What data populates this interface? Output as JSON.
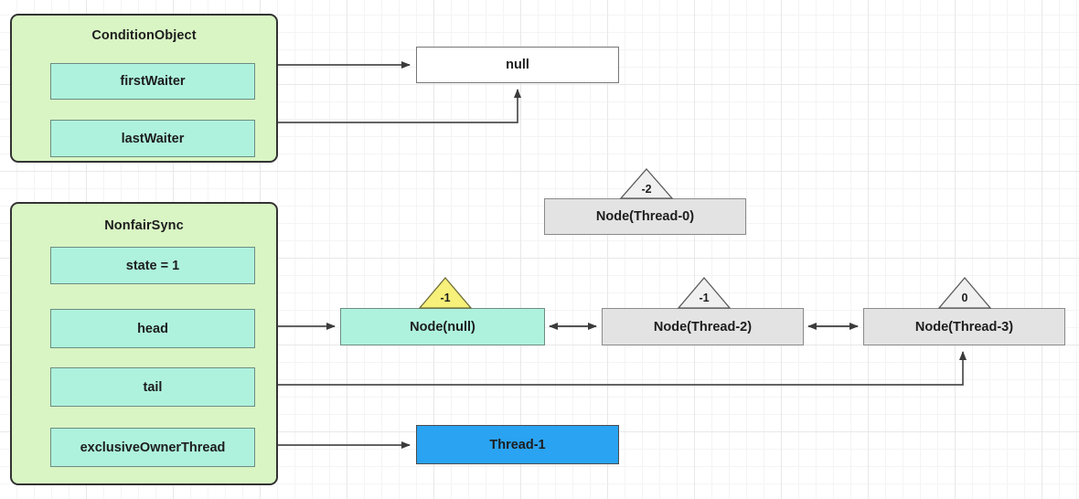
{
  "diagram": {
    "title": "AQS ReentrantLock internal state diagram",
    "colors": {
      "group_fill": "#d9f5c4",
      "field_fill": "#aef2dd",
      "node_gray_fill": "#e3e3e3",
      "node_teal_fill": "#aef2dd",
      "node_white_fill": "#ffffff",
      "thread_blue_fill": "#29a3f2",
      "badge_yellow_fill": "#f7f07a",
      "badge_gray_fill": "#f0f0f0",
      "edge_stroke": "#4d4d4d",
      "border_dark": "#333333"
    }
  },
  "groups": [
    {
      "name": "condition-object",
      "title": "ConditionObject",
      "fields": [
        {
          "name": "first-waiter",
          "label": "firstWaiter"
        },
        {
          "name": "last-waiter",
          "label": "lastWaiter"
        }
      ]
    },
    {
      "name": "nonfair-sync",
      "title": "NonfairSync",
      "fields": [
        {
          "name": "state",
          "label": "state = 1"
        },
        {
          "name": "head",
          "label": "head"
        },
        {
          "name": "tail",
          "label": "tail"
        },
        {
          "name": "exclusive-owner-thread",
          "label": "exclusiveOwnerThread"
        }
      ]
    }
  ],
  "nodes": [
    {
      "name": "null-target",
      "label": "null",
      "badge": null
    },
    {
      "name": "node-thread-0",
      "label": "Node(Thread-0)",
      "badge": "-2"
    },
    {
      "name": "node-null",
      "label": "Node(null)",
      "badge": "-1"
    },
    {
      "name": "node-thread-2",
      "label": "Node(Thread-2)",
      "badge": "-1"
    },
    {
      "name": "node-thread-3",
      "label": "Node(Thread-3)",
      "badge": "0"
    },
    {
      "name": "thread-1",
      "label": "Thread-1",
      "badge": null
    }
  ],
  "edges": [
    {
      "name": "edge-first-waiter-to-null",
      "from": "firstWaiter",
      "to": "null",
      "arrows": "end"
    },
    {
      "name": "edge-last-waiter-to-null",
      "from": "lastWaiter",
      "to": "null",
      "arrows": "end"
    },
    {
      "name": "edge-head-to-node-null",
      "from": "head",
      "to": "Node(null)",
      "arrows": "end"
    },
    {
      "name": "edge-node-null-to-node-thread-2",
      "from": "Node(null)",
      "to": "Node(Thread-2)",
      "arrows": "both"
    },
    {
      "name": "edge-node-thread-2-to-node-thread-3",
      "from": "Node(Thread-2)",
      "to": "Node(Thread-3)",
      "arrows": "both"
    },
    {
      "name": "edge-tail-to-node-thread-3",
      "from": "tail",
      "to": "Node(Thread-3)",
      "arrows": "both"
    },
    {
      "name": "edge-exclusive-owner-thread-to-thread-1",
      "from": "exclusiveOwnerThread",
      "to": "Thread-1",
      "arrows": "end"
    }
  ]
}
